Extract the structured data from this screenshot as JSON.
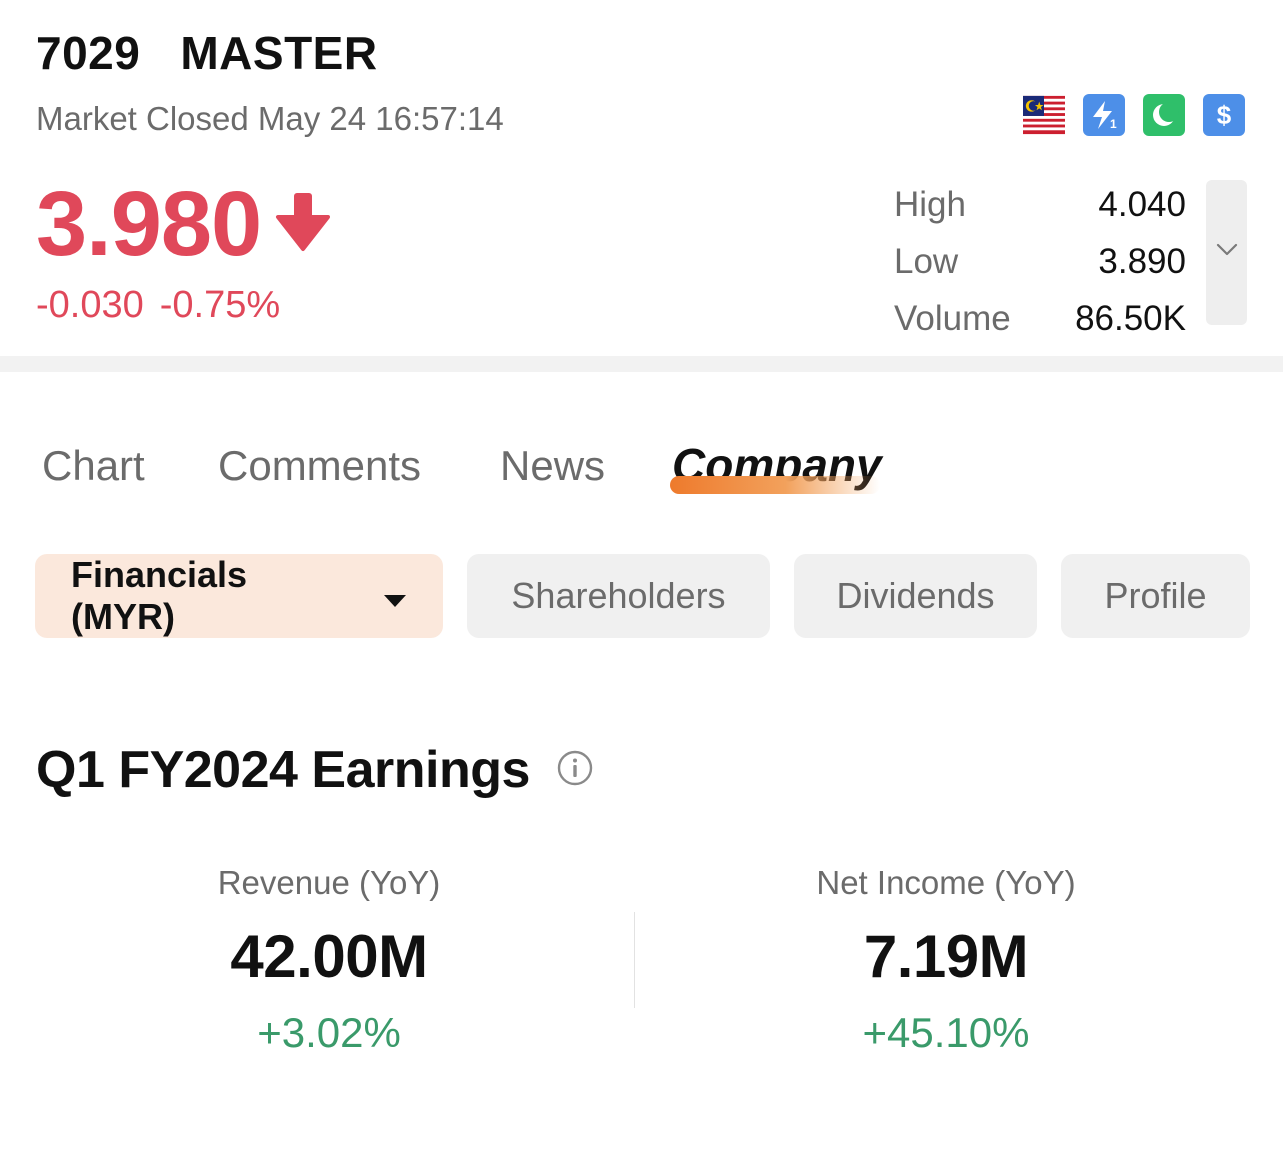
{
  "header": {
    "code": "7029",
    "name": "MASTER",
    "market_status": "Market Closed May 24 16:57:14",
    "badges": [
      "malaysia-flag-icon",
      "lightning-level1-icon",
      "crescent-moon-icon",
      "dollar-icon"
    ],
    "price": "3.980",
    "direction": "down",
    "change": "-0.030",
    "change_pct": "-0.75%",
    "stats": [
      {
        "label": "High",
        "value": "4.040"
      },
      {
        "label": "Low",
        "value": "3.890"
      },
      {
        "label": "Volume",
        "value": "86.50K"
      }
    ]
  },
  "tabs": [
    {
      "label": "Chart"
    },
    {
      "label": "Comments"
    },
    {
      "label": "News"
    },
    {
      "label": "Company",
      "active": true
    }
  ],
  "subtabs": [
    {
      "label": "Financials (MYR)",
      "active": true
    },
    {
      "label": "Shareholders"
    },
    {
      "label": "Dividends"
    },
    {
      "label": "Profile"
    }
  ],
  "earnings": {
    "title": "Q1 FY2024 Earnings",
    "metrics": [
      {
        "label": "Revenue (YoY)",
        "value": "42.00M",
        "change": "+3.02%"
      },
      {
        "label": "Net Income (YoY)",
        "value": "7.19M",
        "change": "+45.10%"
      }
    ]
  },
  "colors": {
    "down": "#e0485a",
    "up": "#3a9a6a",
    "accent": "#ee7a2c"
  }
}
